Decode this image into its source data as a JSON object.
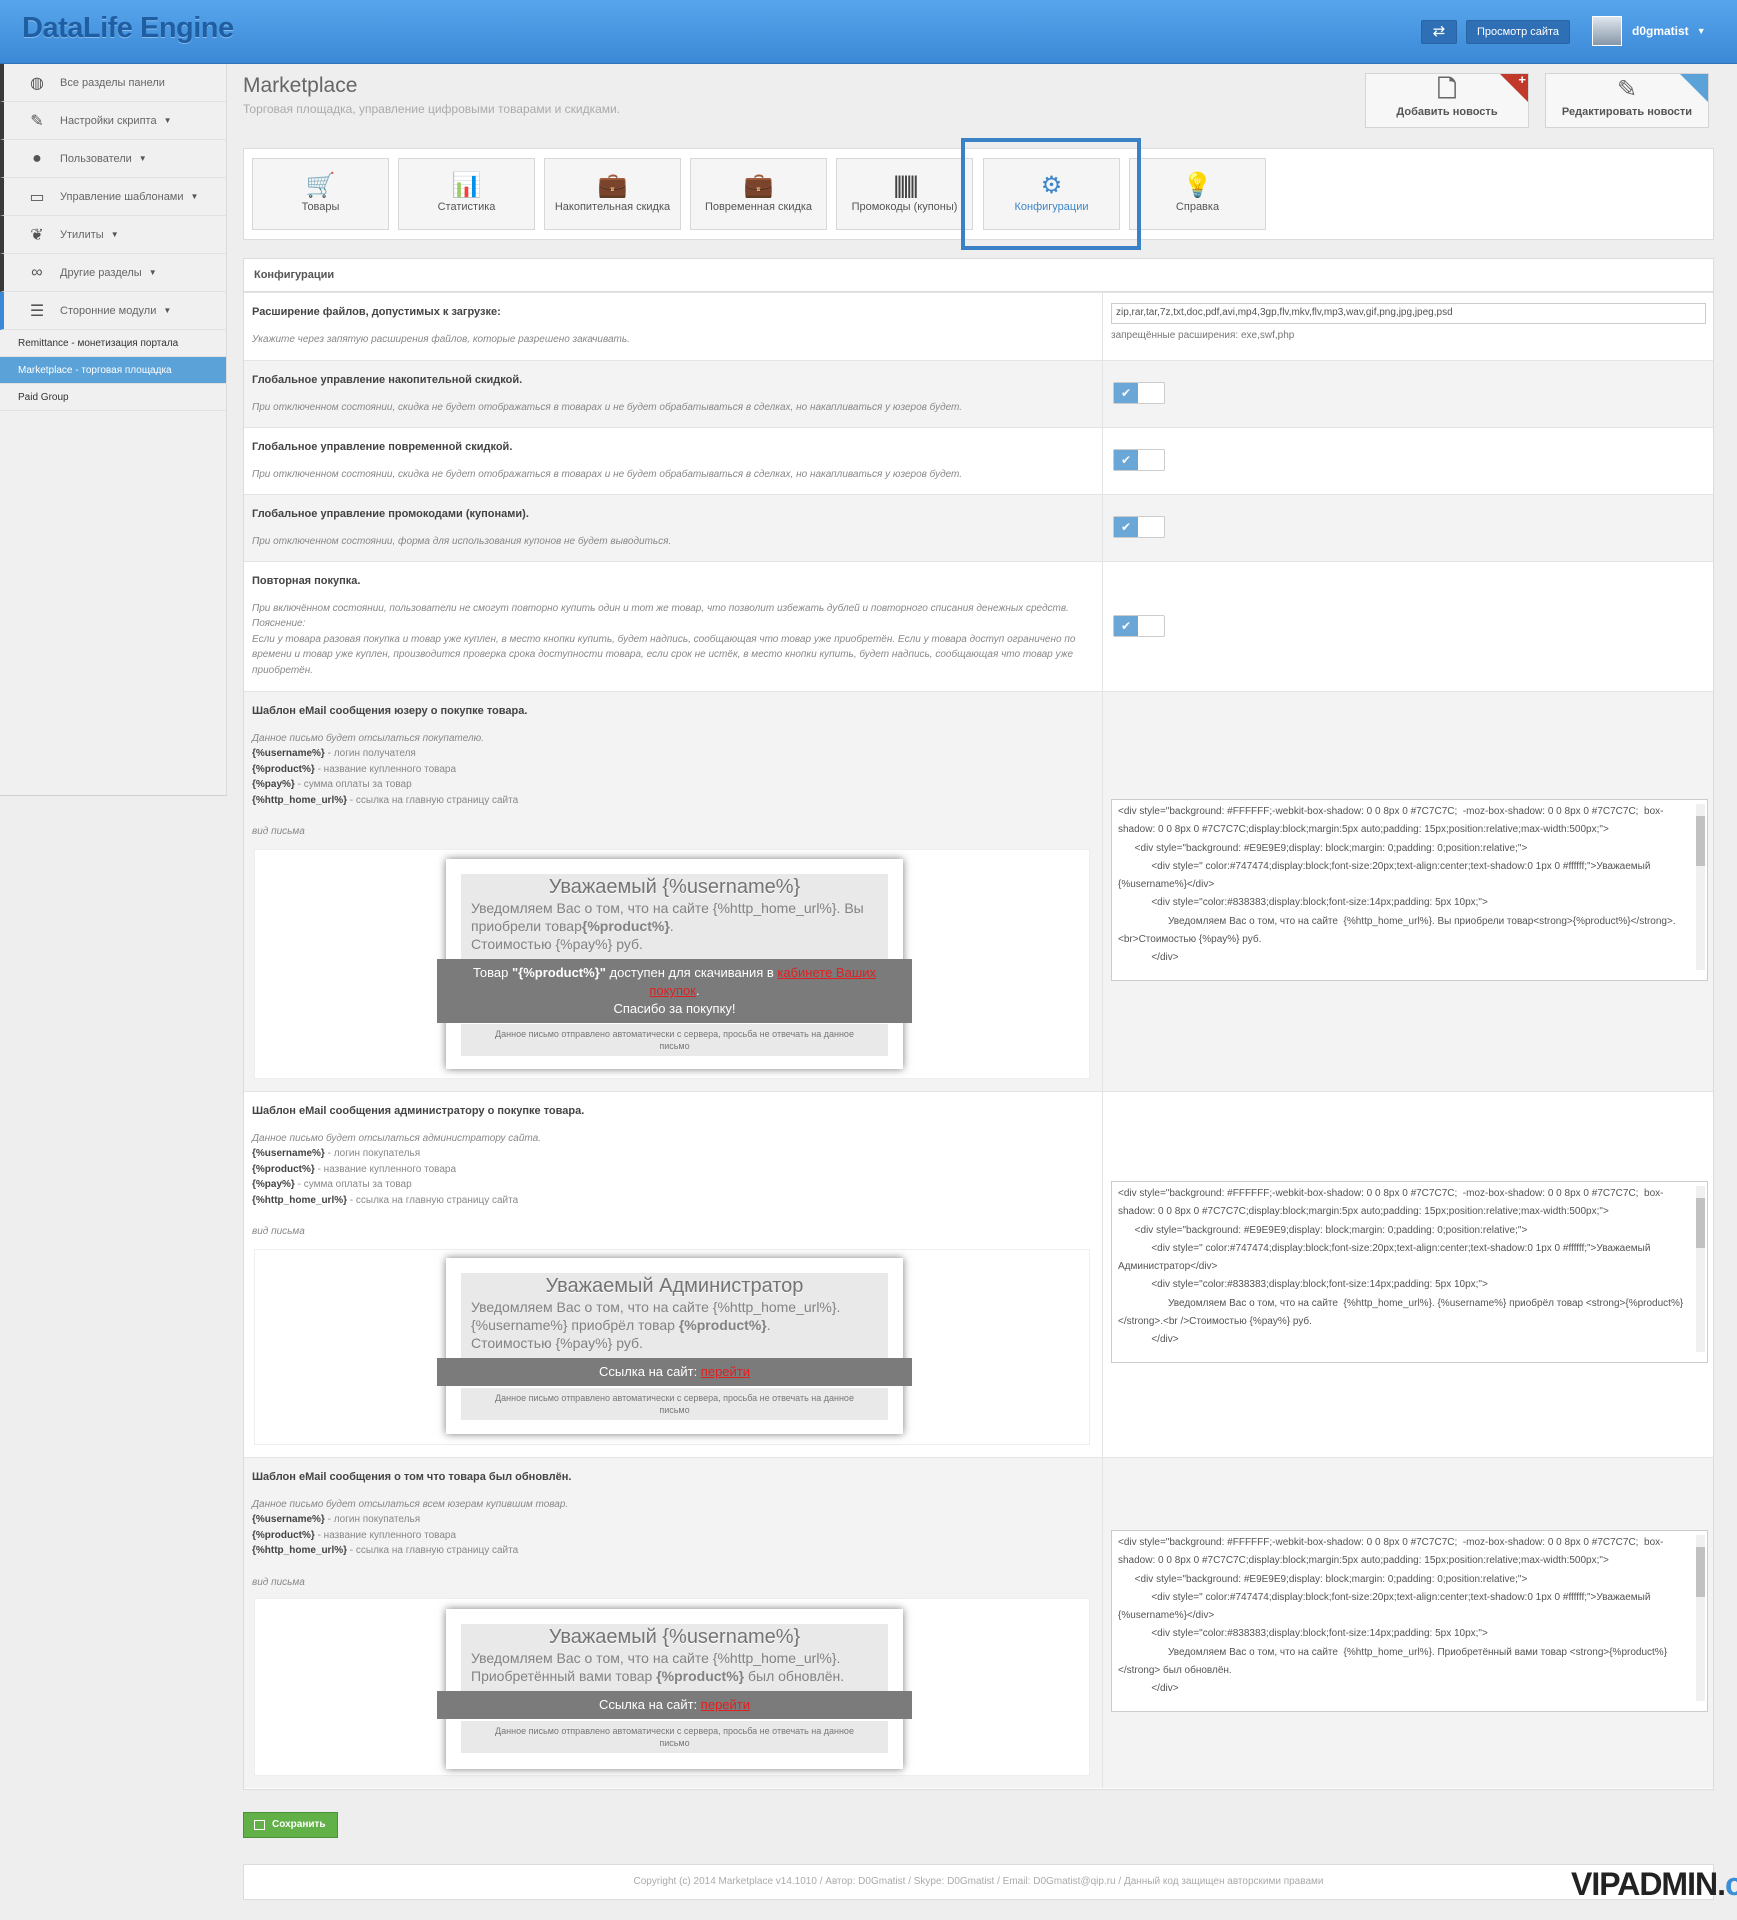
{
  "header": {
    "logo": "DataLife Engine",
    "swap_label": "⇄",
    "view_site": "Просмотр сайта",
    "username": "d0gmatist"
  },
  "sidebar": {
    "items": [
      {
        "label": "Все разделы панели",
        "icon": "globe-icon"
      },
      {
        "label": "Настройки скрипта",
        "icon": "wrench-icon"
      },
      {
        "label": "Пользователи",
        "icon": "user-icon"
      },
      {
        "label": "Управление шаблонами",
        "icon": "monitor-icon"
      },
      {
        "label": "Утилиты",
        "icon": "leaf-icon"
      },
      {
        "label": "Другие разделы",
        "icon": "link-icon"
      },
      {
        "label": "Сторонние модули",
        "icon": "list-icon"
      }
    ],
    "subitems": [
      "Remittance - монетизация портала",
      "Marketplace - торговая площадка",
      "Paid Group"
    ]
  },
  "page": {
    "title": "Marketplace",
    "subtitle": "Торговая площадка, управление цифровыми товарами и скидками."
  },
  "quick": {
    "add_news": "Добавить новость",
    "edit_news": "Редактировать новости"
  },
  "tabs": [
    "Товары",
    "Статистика",
    "Накопительная скидка",
    "Повременная скидка",
    "Промокоды (купоны)",
    "Конфигурации",
    "Справка"
  ],
  "panel_title": "Конфигурации",
  "ext": {
    "title": "Расширение файлов, допустимых к загрузке:",
    "desc": "Укажите через запятую расширения файлов, которые разрешено закачивать.",
    "value": "zip,rar,tar,7z,txt,doc,pdf,avi,mp4,3gp,flv,mkv,flv,mp3,wav,gif,png,jpg,jpeg,psd",
    "hint": "запрещённые расширения: exe,swf,php"
  },
  "accum": {
    "title": "Глобальное управление накопительной скидкой.",
    "desc": "При отключенном состоянии, скидка не будет отображаться в товарах и не будет обрабатываться в сделках, но накапливаться у юзеров будет."
  },
  "timed": {
    "title": "Глобальное управление повременной скидкой.",
    "desc": "При отключенном состоянии, скидка не будет отображаться в товарах и не будет обрабатываться в сделках, но накапливаться у юзеров будет."
  },
  "promo": {
    "title": "Глобальное управление промокодами (купонами).",
    "desc": "При отключенном состоянии, форма для использования купонов не будет выводиться."
  },
  "repeat": {
    "title": "Повторная покупка.",
    "desc": "При включённом состоянии, пользователи не смогут повторно купить один и тот же товар, что позволит избежать дублей и повторного списания денежных средств.",
    "note": "Пояснение:",
    "desc2": "Если у товара разовая покупка и товар уже куплен, в место кнопки купить, будет надпись, сообщающая что товар уже приобретён. Если у товара доступ ограничено по времени и товар уже куплен, производится проверка срока доступности товара, если срок не истёк, в место кнопки купить, будет надпись, сообщающая что товар уже приобретён."
  },
  "tpl1": {
    "title": "Шаблон eMail сообщения юзеру о покупке товара.",
    "desc": "Данное письмо будет отсылаться покупателю.",
    "vars": [
      [
        "{%username%}",
        " - логин получателя"
      ],
      [
        "{%product%}",
        " - название купленного товара"
      ],
      [
        "{%pay%}",
        " - сумма оплаты за товар"
      ],
      [
        "{%http_home_url%}",
        " - ссылка на главную страницу сайта"
      ]
    ],
    "view": "вид письма",
    "mail_title": "Уважаемый {%username%}",
    "mail_body1": "Уведомляем Вас о том, что на сайте {%http_home_url%}. Вы приобрели товар",
    "mail_body_prod": "{%product%}",
    "mail_body2": "Стоимостью {%pay%} руб.",
    "band_a": "Товар ",
    "band_prod": "\"{%product%}\"",
    "band_b": " доступен для скачивания в ",
    "band_link": "кабинете Ваших покупок",
    "band_c": ".",
    "band_thanks": "Спасибо за покупку!",
    "foot": "Данное письмо отправлено автоматически с сервера, просьба не отвечать на данное письмо",
    "code": "<div style=\"background: #FFFFFF;-webkit-box-shadow: 0 0 8px 0 #7C7C7C;  -moz-box-shadow: 0 0 8px 0 #7C7C7C;  box-shadow: 0 0 8px 0 #7C7C7C;display:block;margin:5px auto;padding: 15px;position:relative;max-width:500px;\">\n      <div style=\"background: #E9E9E9;display: block;margin: 0;padding: 0;position:relative;\">\n            <div style=\" color:#747474;display:block;font-size:20px;text-align:center;text-shadow:0 1px 0 #ffffff;\">Уважаемый {%username%}</div>\n            <div style=\"color:#838383;display:block;font-size:14px;padding: 5px 10px;\">\n                  Уведомляем Вас о том, что на сайте  {%http_home_url%}. Вы приобрели товар<strong>{%product%}</strong>.<br>Стоимостью {%pay%} руб.\n            </div>"
  },
  "tpl2": {
    "title": "Шаблон eMail сообщения администратору о покупке товара.",
    "desc": "Данное письмо будет отсылаться администратору сайта.",
    "vars": [
      [
        "{%username%}",
        " - логин покупателья"
      ],
      [
        "{%product%}",
        " - название купленного товара"
      ],
      [
        "{%pay%}",
        " - сумма оплаты за товар"
      ],
      [
        "{%http_home_url%}",
        " - ссылка на главную страницу сайта"
      ]
    ],
    "view": "вид письма",
    "mail_title": "Уважаемый Администратор",
    "mail_body1": "Уведомляем Вас о том, что на сайте {%http_home_url%}.",
    "mail_body_user": "{%username%}",
    "mail_body_mid": " приобрёл товар ",
    "mail_body_prod": "{%product%}",
    "mail_body2": "Стоимостью {%pay%} руб.",
    "band_a": "Ссылка на сайт: ",
    "band_link": "перейти",
    "foot": "Данное письмо отправлено автоматически с сервера, просьба не отвечать на данное письмо",
    "code": "<div style=\"background: #FFFFFF;-webkit-box-shadow: 0 0 8px 0 #7C7C7C;  -moz-box-shadow: 0 0 8px 0 #7C7C7C;  box-shadow: 0 0 8px 0 #7C7C7C;display:block;margin:5px auto;padding: 15px;position:relative;max-width:500px;\">\n      <div style=\"background: #E9E9E9;display: block;margin: 0;padding: 0;position:relative;\">\n            <div style=\" color:#747474;display:block;font-size:20px;text-align:center;text-shadow:0 1px 0 #ffffff;\">Уважаемый Администратор</div>\n            <div style=\"color:#838383;display:block;font-size:14px;padding: 5px 10px;\">\n                  Уведомляем Вас о том, что на сайте  {%http_home_url%}. {%username%} приобрёл товар <strong>{%product%}</strong>.<br />Стоимостью {%pay%} руб.\n            </div>"
  },
  "tpl3": {
    "title": "Шаблон eMail сообщения о том что товара был обновлён.",
    "desc": "Данное письмо будет отсылаться всем юзерам купившим товар.",
    "vars": [
      [
        "{%username%}",
        " - логин покупателья"
      ],
      [
        "{%product%}",
        " - название купленного товара"
      ],
      [
        "{%http_home_url%}",
        " - ссылка на главную страницу сайта"
      ]
    ],
    "view": "вид письма",
    "mail_title": "Уважаемый {%username%}",
    "mail_body1": "Уведомляем Вас о том, что на сайте {%http_home_url%}.",
    "mail_body_mid": "Приобретённый вами товар ",
    "mail_body_prod": "{%product%}",
    "mail_body2": " был обновлён.",
    "band_a": "Ссылка на сайт: ",
    "band_link": "перейти",
    "foot": "Данное письмо отправлено автоматически с сервера, просьба не отвечать на данное письмо",
    "code": "<div style=\"background: #FFFFFF;-webkit-box-shadow: 0 0 8px 0 #7C7C7C;  -moz-box-shadow: 0 0 8px 0 #7C7C7C;  box-shadow: 0 0 8px 0 #7C7C7C;display:block;margin:5px auto;padding: 15px;position:relative;max-width:500px;\">\n      <div style=\"background: #E9E9E9;display: block;margin: 0;padding: 0;position:relative;\">\n            <div style=\" color:#747474;display:block;font-size:20px;text-align:center;text-shadow:0 1px 0 #ffffff;\">Уважаемый {%username%}</div>\n            <div style=\"color:#838383;display:block;font-size:14px;padding: 5px 10px;\">\n                  Уведомляем Вас о том, что на сайте  {%http_home_url%}. Приобретённый вами товар <strong>{%product%}</strong> был обновлён.\n            </div>"
  },
  "save_label": "Сохранить",
  "footer": "Copyright (c) 2014 Marketplace v14.1010 / Автор: D0Gmatist / Skype: D0Gmatist / Email: D0Gmatist@qip.ru / Данный код защищен авторскими правами",
  "watermark": {
    "a": "VIPADMIN.",
    "b": "club"
  },
  "colors": {
    "accent": "#3b88d6",
    "save": "#62b048",
    "link": "#e02020"
  }
}
